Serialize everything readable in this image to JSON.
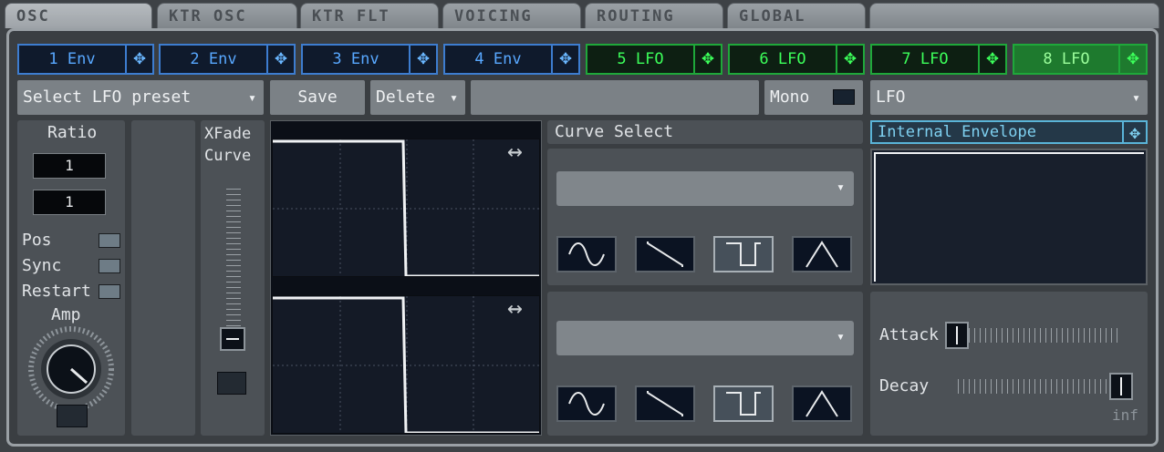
{
  "tabs": [
    "OSC",
    "KTR OSC",
    "KTR FLT",
    "VOICING",
    "ROUTING",
    "GLOBAL"
  ],
  "slots": [
    {
      "label": "1 Env",
      "type": "env"
    },
    {
      "label": "2 Env",
      "type": "env"
    },
    {
      "label": "3 Env",
      "type": "env"
    },
    {
      "label": "4 Env",
      "type": "env"
    },
    {
      "label": "5 LFO",
      "type": "lfo"
    },
    {
      "label": "6 LFO",
      "type": "lfo"
    },
    {
      "label": "7 LFO",
      "type": "lfo"
    },
    {
      "label": "8 LFO",
      "type": "lfo",
      "selected": true
    }
  ],
  "toolbar": {
    "preset_label": "Select LFO preset",
    "save_label": "Save",
    "delete_label": "Delete",
    "name_value": "",
    "mono_label": "Mono",
    "mode_label": "LFO"
  },
  "left": {
    "ratio_label": "Ratio",
    "ratio_top": "1",
    "ratio_bottom": "1",
    "pos_label": "Pos",
    "sync_label": "Sync",
    "restart_label": "Restart",
    "amp_label": "Amp"
  },
  "xfade": {
    "line1": "XFade",
    "line2": "Curve"
  },
  "curve_select_label": "Curve Select",
  "internal_env_label": "Internal Envelope",
  "env": {
    "attack_label": "Attack",
    "decay_label": "Decay",
    "decay_value": "inf",
    "attack_level": 0.0,
    "decay_level": 1.0
  },
  "icons": {
    "move": "move-arrows-icon",
    "h_arrow": "horizontal-arrows-icon"
  }
}
